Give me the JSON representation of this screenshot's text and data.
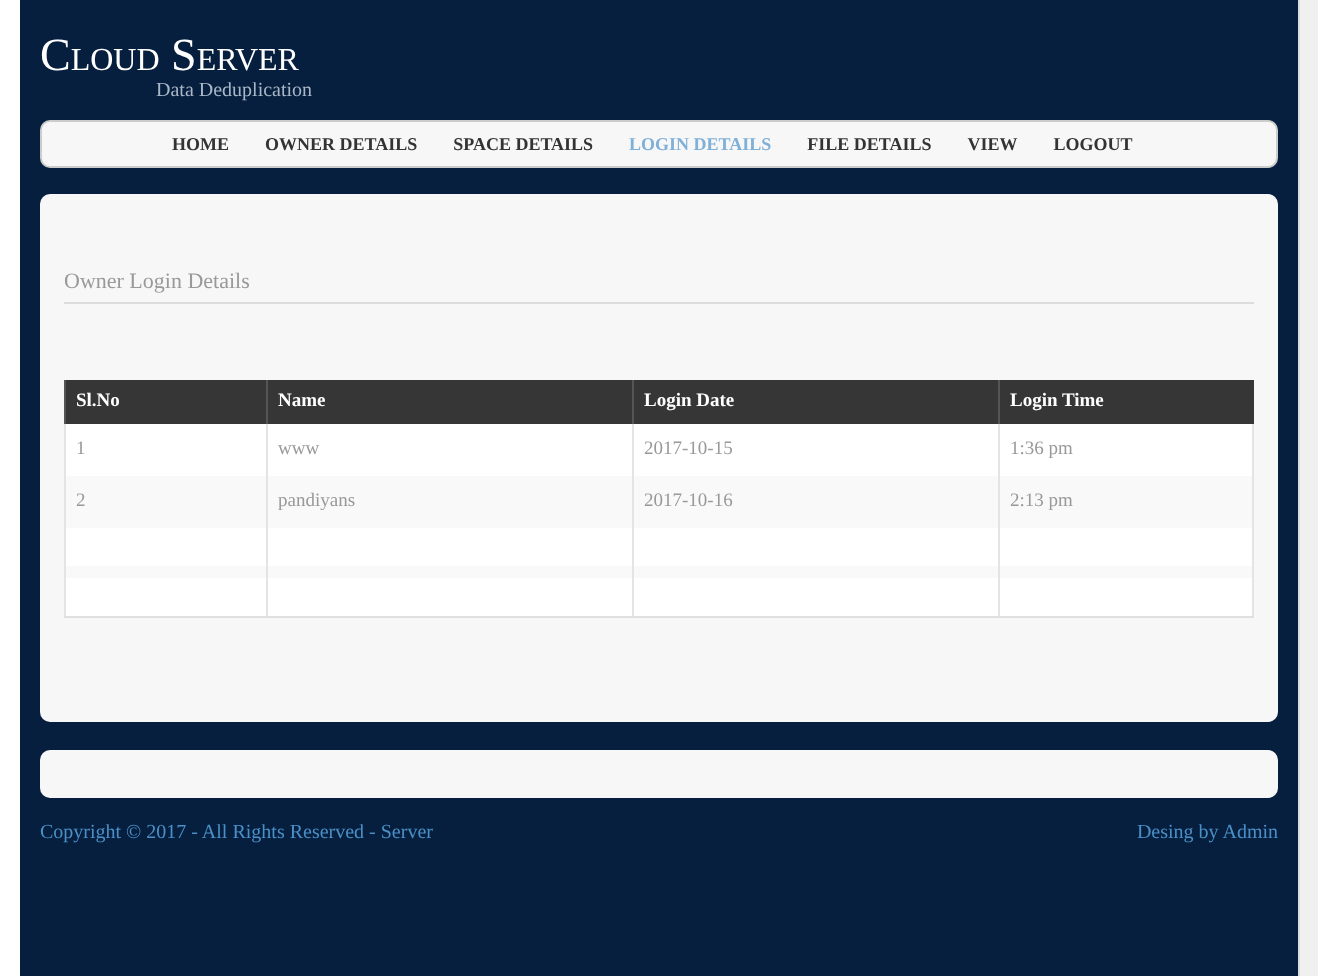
{
  "header": {
    "title": "Cloud Server",
    "subtitle": "Data Deduplication"
  },
  "nav": [
    {
      "label": "HOME",
      "selected": false
    },
    {
      "label": "OWNER DETAILS",
      "selected": false
    },
    {
      "label": "SPACE DETAILS",
      "selected": false
    },
    {
      "label": "LOGIN DETAILS",
      "selected": true
    },
    {
      "label": "FILE DETAILS",
      "selected": false
    },
    {
      "label": "VIEW",
      "selected": false
    },
    {
      "label": "LOGOUT",
      "selected": false
    }
  ],
  "panel": {
    "heading": "Owner Login Details"
  },
  "table": {
    "columns": [
      "Sl.No",
      "Name",
      "Login Date",
      "Login Time"
    ],
    "rows": [
      [
        "1",
        "www",
        "2017-10-15",
        "1:36 pm"
      ],
      [
        "2",
        "pandiyans",
        "2017-10-16",
        "2:13 pm"
      ]
    ]
  },
  "footer": {
    "copyright": "Copyright © 2017 - All Rights Reserved - Server",
    "credit": "Desing by Admin"
  }
}
